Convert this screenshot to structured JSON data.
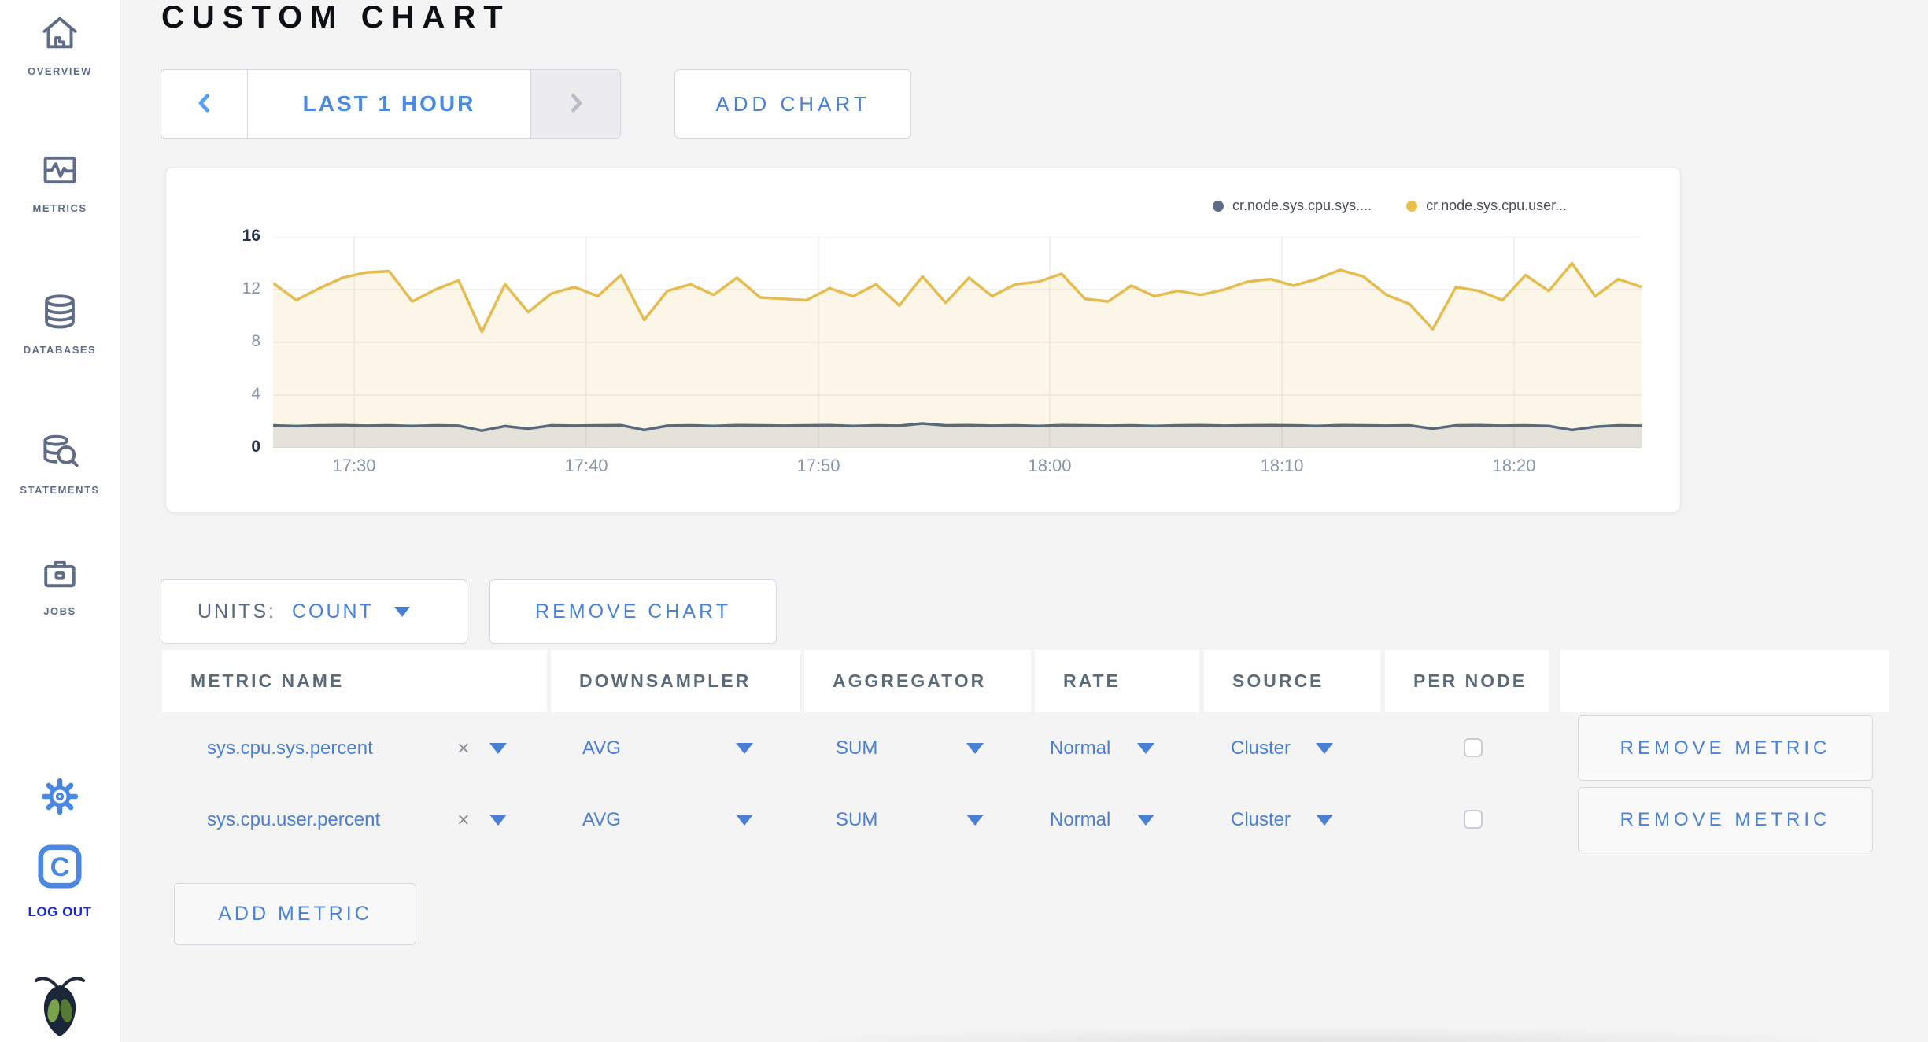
{
  "title": "CUSTOM CHART",
  "time_selector": {
    "label": "LAST 1 HOUR",
    "prev_icon": "chevron-left",
    "next_icon": "chevron-right-disabled"
  },
  "add_chart_label": "ADD CHART",
  "legend": [
    {
      "label": "cr.node.sys.cpu.sys....",
      "color": "#5f6c87"
    },
    {
      "label": "cr.node.sys.cpu.user...",
      "color": "#e9c04b"
    }
  ],
  "chart_data": {
    "type": "line",
    "title": "",
    "xlabel": "",
    "ylabel": "",
    "ylim": [
      0,
      16
    ],
    "y_ticks": [
      16,
      12,
      8,
      4,
      0
    ],
    "x_ticks": [
      "17:30",
      "17:40",
      "17:50",
      "18:00",
      "18:10",
      "18:20"
    ],
    "x_range": "last 1 hour (~17:26 - 18:25)",
    "grid": "on",
    "legend_position": "top-right",
    "series": [
      {
        "name": "cr.node.sys.cpu.sys....",
        "color": "#5a6a7d",
        "fill": "rgba(90,106,125,0.14)",
        "values": [
          1.7,
          1.65,
          1.7,
          1.72,
          1.68,
          1.7,
          1.66,
          1.7,
          1.68,
          1.3,
          1.65,
          1.45,
          1.7,
          1.68,
          1.7,
          1.72,
          1.35,
          1.68,
          1.7,
          1.66,
          1.72,
          1.7,
          1.68,
          1.7,
          1.72,
          1.66,
          1.7,
          1.68,
          1.85,
          1.7,
          1.72,
          1.68,
          1.7,
          1.66,
          1.72,
          1.7,
          1.68,
          1.7,
          1.66,
          1.7,
          1.72,
          1.68,
          1.7,
          1.72,
          1.7,
          1.66,
          1.72,
          1.7,
          1.68,
          1.7,
          1.45,
          1.7,
          1.72,
          1.68,
          1.7,
          1.66,
          1.35,
          1.6,
          1.7,
          1.68
        ]
      },
      {
        "name": "cr.node.sys.cpu.user...",
        "color": "#e7bc4f",
        "fill": "rgba(231,188,79,0.13)",
        "values": [
          12.5,
          11.2,
          12.1,
          12.9,
          13.3,
          13.4,
          11.1,
          12.0,
          12.7,
          8.8,
          12.4,
          10.3,
          11.7,
          12.2,
          11.5,
          13.1,
          9.7,
          11.9,
          12.4,
          11.6,
          12.9,
          11.4,
          11.3,
          11.2,
          12.1,
          11.5,
          12.4,
          10.8,
          13.0,
          11.0,
          12.9,
          11.5,
          12.4,
          12.6,
          13.2,
          11.3,
          11.1,
          12.3,
          11.5,
          11.9,
          11.6,
          12.0,
          12.6,
          12.8,
          12.3,
          12.8,
          13.5,
          13.0,
          11.6,
          10.9,
          9.0,
          12.2,
          11.9,
          11.2,
          13.1,
          11.9,
          14.0,
          11.5,
          12.8,
          12.2
        ]
      }
    ]
  },
  "units": {
    "prefix": "UNITS:",
    "value": "COUNT"
  },
  "remove_chart_label": "REMOVE CHART",
  "table": {
    "headers": [
      "METRIC NAME",
      "DOWNSAMPLER",
      "AGGREGATOR",
      "RATE",
      "SOURCE",
      "PER NODE",
      ""
    ],
    "remove_label": "REMOVE METRIC",
    "rows": [
      {
        "metric": "sys.cpu.sys.percent",
        "downsampler": "AVG",
        "aggregator": "SUM",
        "rate": "Normal",
        "source": "Cluster",
        "per_node_checked": false
      },
      {
        "metric": "sys.cpu.user.percent",
        "downsampler": "AVG",
        "aggregator": "SUM",
        "rate": "Normal",
        "source": "Cluster",
        "per_node_checked": false
      }
    ]
  },
  "add_metric_label": "ADD METRIC",
  "sidebar": {
    "items": [
      {
        "icon": "home-icon",
        "label": "OVERVIEW"
      },
      {
        "icon": "metrics-icon",
        "label": "METRICS"
      },
      {
        "icon": "databases-icon",
        "label": "DATABASES"
      },
      {
        "icon": "statements-icon",
        "label": "STATEMENTS"
      },
      {
        "icon": "jobs-icon",
        "label": "JOBS"
      }
    ],
    "settings_icon": "gear-icon",
    "logout_icon": "logout-c-icon",
    "logout_label": "LOG OUT",
    "logo_icon": "cockroachdb-bug-logo"
  },
  "colors": {
    "accent_blue": "#4a82d8",
    "selector_blue": "#4a8ae0",
    "chevron_blue": "#55a0f0",
    "slate": "#5f6c87",
    "logout_blue": "#1d2bd8",
    "page_bg": "#f4f4f5",
    "panel_bg": "#ffffff",
    "grid": "#ededee",
    "axis_label": "#8795ab",
    "axis_label_dark": "#26344d",
    "series_yellow": "#e7bc4f",
    "series_slate": "#5a6a7d",
    "header_text": "#5c6b7a",
    "title_text": "#0c0f14"
  }
}
